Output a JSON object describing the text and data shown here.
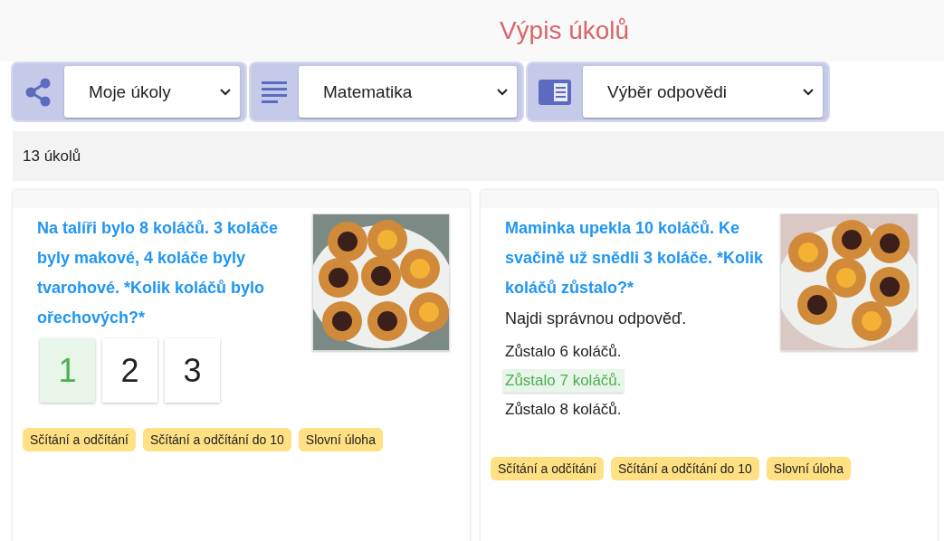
{
  "header": {
    "title": "Výpis úkolů"
  },
  "filters": [
    {
      "kind": "share",
      "value": "Moje úkoly"
    },
    {
      "kind": "lines",
      "value": "Matematika"
    },
    {
      "kind": "panel",
      "value": "Výběr odpovědi"
    }
  ],
  "count": "13 úkolů",
  "cards": [
    {
      "kind": "number-choice",
      "question": "Na talíři bylo 8 koláčů. 3 koláče byly makové, 4 koláče byly tvarohové. *Kolik koláčů bylo ořechových?*",
      "options": [
        {
          "label": "1",
          "selected": true
        },
        {
          "label": "2",
          "selected": false
        },
        {
          "label": "3",
          "selected": false
        }
      ],
      "tags": [
        "Sčítání a odčítání",
        "Sčítání a odčítání do 10",
        "Slovní úloha"
      ]
    },
    {
      "kind": "text-choice",
      "question": "Maminka upekla 10 koláčů. Ke svačině už snědli 3 koláče. *Kolik koláčů zůstalo?*",
      "instruction": "Najdi správnou odpověď.",
      "options": [
        {
          "label": "Zůstalo 6 koláčů.",
          "selected": false
        },
        {
          "label": "Zůstalo 7 koláčů.",
          "selected": true
        },
        {
          "label": "Zůstalo 8 koláčů.",
          "selected": false
        }
      ],
      "tags": [
        "Sčítání a odčítání",
        "Sčítání a odčítání do 10",
        "Slovní úloha"
      ]
    }
  ]
}
